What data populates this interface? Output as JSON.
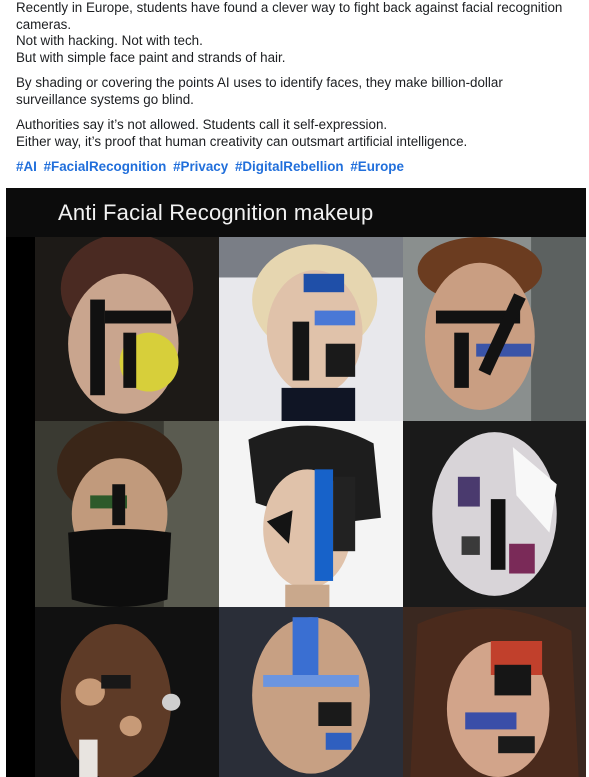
{
  "post": {
    "paragraphs": [
      [
        "Recently in Europe, students have found a clever way to fight back against facial recognition cameras.",
        "Not with hacking. Not with tech.",
        "But with simple face paint and strands of hair."
      ],
      [
        "By shading or covering the points AI uses to identify faces, they make billion-dollar surveillance systems go blind."
      ],
      [
        "Authorities say it’s not allowed. Students call it self-expression.",
        "Either way, it’s proof that human creativity can outsmart artificial intelligence."
      ]
    ],
    "hashtags": [
      "#AI",
      "#FacialRecognition",
      "#Privacy",
      "#DigitalRebellion",
      "#Europe"
    ]
  },
  "image": {
    "title": "Anti Facial Recognition makeup",
    "tiles": 9
  },
  "colors": {
    "hashtag": "#216fdb",
    "text": "#1c1e21",
    "image_bg": "#000000"
  }
}
